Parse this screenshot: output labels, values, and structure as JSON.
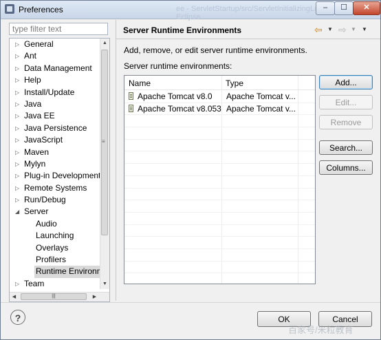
{
  "window": {
    "title": "Preferences",
    "faint_title": "ee - ServletStartup/src/ServletInitializingLaunch.java - Eclipse",
    "min_glyph": "–",
    "max_glyph": "☐",
    "close_glyph": "✕"
  },
  "filter": {
    "placeholder": "type filter text"
  },
  "tree": {
    "items": [
      {
        "label": "General",
        "arrow": "▷"
      },
      {
        "label": "Ant",
        "arrow": "▷"
      },
      {
        "label": "Data Management",
        "arrow": "▷"
      },
      {
        "label": "Help",
        "arrow": "▷"
      },
      {
        "label": "Install/Update",
        "arrow": "▷"
      },
      {
        "label": "Java",
        "arrow": "▷"
      },
      {
        "label": "Java EE",
        "arrow": "▷"
      },
      {
        "label": "Java Persistence",
        "arrow": "▷"
      },
      {
        "label": "JavaScript",
        "arrow": "▷"
      },
      {
        "label": "Maven",
        "arrow": "▷"
      },
      {
        "label": "Mylyn",
        "arrow": "▷"
      },
      {
        "label": "Plug-in Development",
        "arrow": "▷"
      },
      {
        "label": "Remote Systems",
        "arrow": "▷"
      },
      {
        "label": "Run/Debug",
        "arrow": "▷"
      },
      {
        "label": "Server",
        "arrow": "◢"
      },
      {
        "label": "Audio"
      },
      {
        "label": "Launching"
      },
      {
        "label": "Overlays"
      },
      {
        "label": "Profilers"
      },
      {
        "label": "Runtime Environm",
        "selected": true
      },
      {
        "label": "Team",
        "arrow": "▷"
      }
    ],
    "vscroll_up": "▲",
    "vscroll_down": "▼",
    "vscroll_grip": "≡",
    "hscroll_left": "◀",
    "hscroll_right": "▶",
    "hscroll_grip": "|||"
  },
  "page": {
    "title": "Server Runtime Environments",
    "back_icon": "⇦",
    "forward_icon": "⇨",
    "dropdown": "▼",
    "description": "Add, remove, or edit server runtime environments.",
    "table_label": "Server runtime environments:"
  },
  "table": {
    "columns": [
      "Name",
      "Type"
    ],
    "rows": [
      {
        "name": "Apache Tomcat v8.0",
        "type": "Apache Tomcat v..."
      },
      {
        "name": "Apache Tomcat v8.053",
        "type": "Apache Tomcat v..."
      }
    ]
  },
  "buttons": {
    "add": "Add...",
    "edit": "Edit...",
    "remove": "Remove",
    "search": "Search...",
    "columns": "Columns..."
  },
  "footer": {
    "help": "?",
    "ok": "OK",
    "cancel": "Cancel",
    "watermark": "百家号/米粒教育"
  }
}
